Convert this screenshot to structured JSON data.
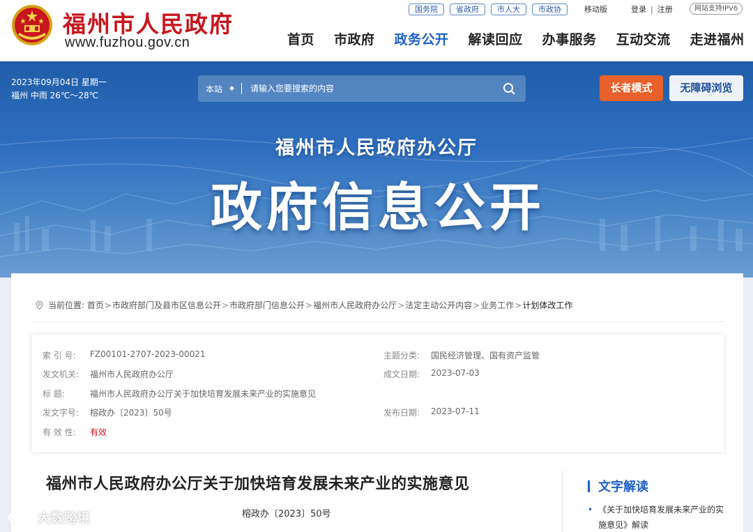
{
  "header": {
    "site_name": "福州市人民政府",
    "site_url": "www.fuzhou.gov.cn",
    "top_tags": [
      "国务院",
      "省政府",
      "市人大",
      "市政协"
    ],
    "mobile": "移动版",
    "login": "登录",
    "register": "注册",
    "login_sep": "|",
    "ipv6": "网站支持IPV6",
    "nav": [
      {
        "label": "首页",
        "active": false
      },
      {
        "label": "市政府",
        "active": false
      },
      {
        "label": "政务公开",
        "active": true
      },
      {
        "label": "解读回应",
        "active": false
      },
      {
        "label": "办事服务",
        "active": false
      },
      {
        "label": "互动交流",
        "active": false
      },
      {
        "label": "走进福州",
        "active": false
      }
    ],
    "brand_red": "#c8161d",
    "active_blue": "#1d5fc4"
  },
  "banner": {
    "date": "2023年09月04日 星期一",
    "weather": "福州 中雨 26℃～28℃",
    "search_scope": "本站",
    "search_placeholder": "请输入您要搜索的内容",
    "btn_elder": "长者模式",
    "btn_access": "无障碍浏览",
    "subtitle": "福州市人民政府办公厅",
    "title": "政府信息公开",
    "elder_color": "#e8612b"
  },
  "breadcrumb": {
    "label": "当前位置:",
    "sep": ">",
    "items": [
      "首页",
      "市政府部门及县市区信息公开",
      "市政府部门信息公开",
      "福州市人民政府办公厅",
      "法定主动公开内容",
      "业务工作",
      "计划体改工作"
    ]
  },
  "meta": {
    "index_label": "索 引 号:",
    "index": "FZ00101-2707-2023-00021",
    "theme_label": "主题分类:",
    "theme": "国民经济管理、国有资产监管",
    "issuer_label": "发文机关:",
    "issuer": "福州市人民政府办公厅",
    "date_label": "成文日期:",
    "date": "2023-07-03",
    "title_label": "标 题:",
    "title": "福州市人民政府办公厅关于加快培育发展未来产业的实施意见",
    "docno_label": "发文字号:",
    "docno": "榕政办〔2023〕50号",
    "pubdate_label": "发布日期:",
    "pubdate": "2023-07-11",
    "validity_label": "有 效 性:",
    "validity": "有效"
  },
  "document": {
    "title": "福州市人民政府办公厅关于加快培育发展未来产业的实施意见",
    "number": "榕政办〔2023〕50号"
  },
  "sidebar": {
    "title": "文字解读",
    "link": "《关于加快培育发展未来产业的实施意见》解读"
  },
  "watermark": "大数跨境"
}
